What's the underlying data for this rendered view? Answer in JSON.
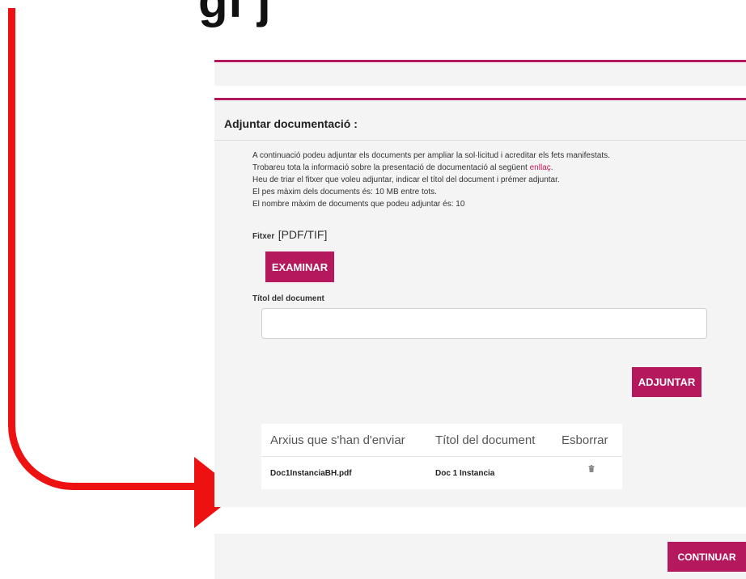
{
  "heading": {
    "partial_text": "gi                       j"
  },
  "panel": {
    "title": "Adjuntar documentació :",
    "info": {
      "line1": "A continuació podeu adjuntar els documents per ampliar la sol·licitud i acreditar els fets manifestats.",
      "line2_prefix": "Trobareu tota la informació sobre la presentació de documentació al següent ",
      "line2_link": "enllaç",
      "line2_suffix": ".",
      "line3": "Heu de triar el fitxer que voleu adjuntar, indicar el títol del document i prémer adjuntar.",
      "line4": "El pes màxim dels documents és: 10 MB entre tots.",
      "line5": "El nombre màxim de documents que podeu adjuntar és: 10"
    },
    "fitxer_label": "Fitxer",
    "fitxer_types": "[PDF/TIF]",
    "examinar_label": "EXAMINAR",
    "titol_label": "Títol del document",
    "titol_value": "",
    "adjuntar_label": "ADJUNTAR",
    "table": {
      "headers": [
        "Arxius que s'han d'enviar",
        "Títol del document",
        "Esborrar"
      ],
      "rows": [
        {
          "file": "Doc1InstanciaBH.pdf",
          "title": "Doc 1 Instancia",
          "delete_icon": "trash-icon"
        }
      ]
    }
  },
  "footer": {
    "continuar_label": "CONTINUAR"
  },
  "colors": {
    "accent": "#b5185c",
    "arrow": "#ee1111",
    "panel_bg": "#f4f4f4"
  }
}
